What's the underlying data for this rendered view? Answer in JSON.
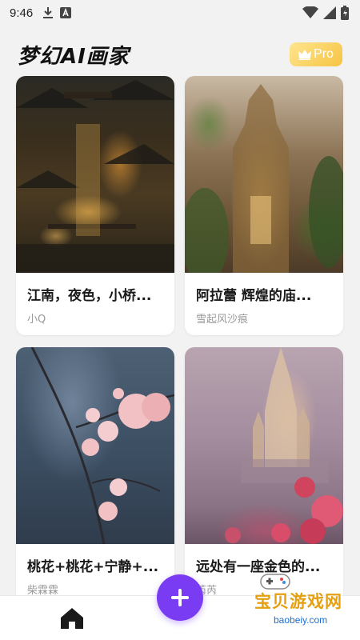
{
  "status_bar": {
    "time": "9:46"
  },
  "header": {
    "title": "梦幻AI画家",
    "pro_label": "Pro"
  },
  "cards": [
    {
      "title": "江南，夜色，小桥...",
      "author": "小Q"
    },
    {
      "title": "阿拉蕾   辉煌的庙...",
      "author": "雪起风沙痕"
    },
    {
      "title": "桃花+桃花+宁静+...",
      "author": "柴霖霖"
    },
    {
      "title": "远处有一座金色的...",
      "author": "芮芮"
    }
  ],
  "watermark": {
    "text": "宝贝游戏网",
    "url": "baobeiy.com"
  },
  "colors": {
    "accent": "#7a3cf2",
    "pro_badge": "#f6c443",
    "background": "#f2f2f2"
  }
}
